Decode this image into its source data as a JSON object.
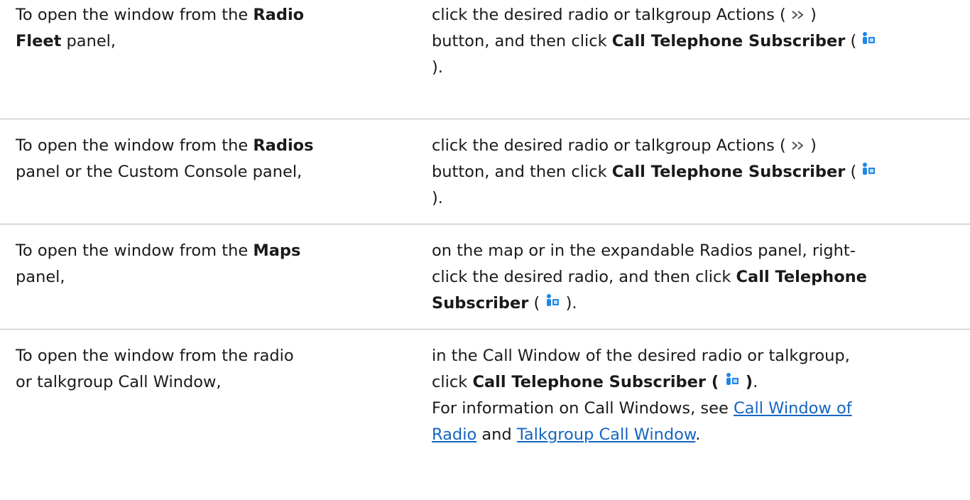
{
  "rows": [
    {
      "left": {
        "pre": "To open the window from the ",
        "bold1": "Radio",
        "bold2": "Fleet",
        "post": " panel,"
      },
      "right": {
        "l1": "click the desired radio or talkgroup Actions ( ",
        "l1_end": " )",
        "l2": "button, and then click ",
        "l2_bold": "Call Telephone Subscriber",
        "l2_end": " (",
        "l3": " )."
      }
    },
    {
      "left": {
        "pre": "To open the window from the ",
        "bold": "Radios",
        "l2": "panel or the Custom Console panel,"
      },
      "right": {
        "l1": "click the desired radio or talkgroup Actions ( ",
        "l1_end": " )",
        "l2": "button, and then click ",
        "l2_bold": "Call Telephone Subscriber",
        "l2_end": " (",
        "l3": " )."
      }
    },
    {
      "left": {
        "pre": "To open the window from the ",
        "bold": "Maps",
        "l2": "panel,"
      },
      "right": {
        "l1": "on the map or in the expandable Radios panel, right-",
        "l2": "click the desired radio, and then click ",
        "l2_bold": "Call Telephone",
        "l3_bold": "Subscriber",
        "l3_mid": " ( ",
        "l3_end": " )."
      }
    },
    {
      "left": {
        "l1": "To open the window from the radio",
        "l2": "or talkgroup Call Window,"
      },
      "right": {
        "l1": "in the Call Window of the desired radio or talkgroup,",
        "l2": "click ",
        "l2_bold": "Call Telephone Subscriber ( ",
        "l2_bold_end": " )",
        "l2_end": ".",
        "l3": "For information on Call Windows, see ",
        "link1_a": "Call Window of",
        "link1_b": "Radio",
        "mid": " and ",
        "link2": "Talkgroup Call Window",
        "end": "."
      }
    }
  ],
  "icons": {
    "actions": "double-chevron-right-icon",
    "call_telephone_subscriber": "telephone-subscriber-icon",
    "accent": "#1e88e5"
  }
}
